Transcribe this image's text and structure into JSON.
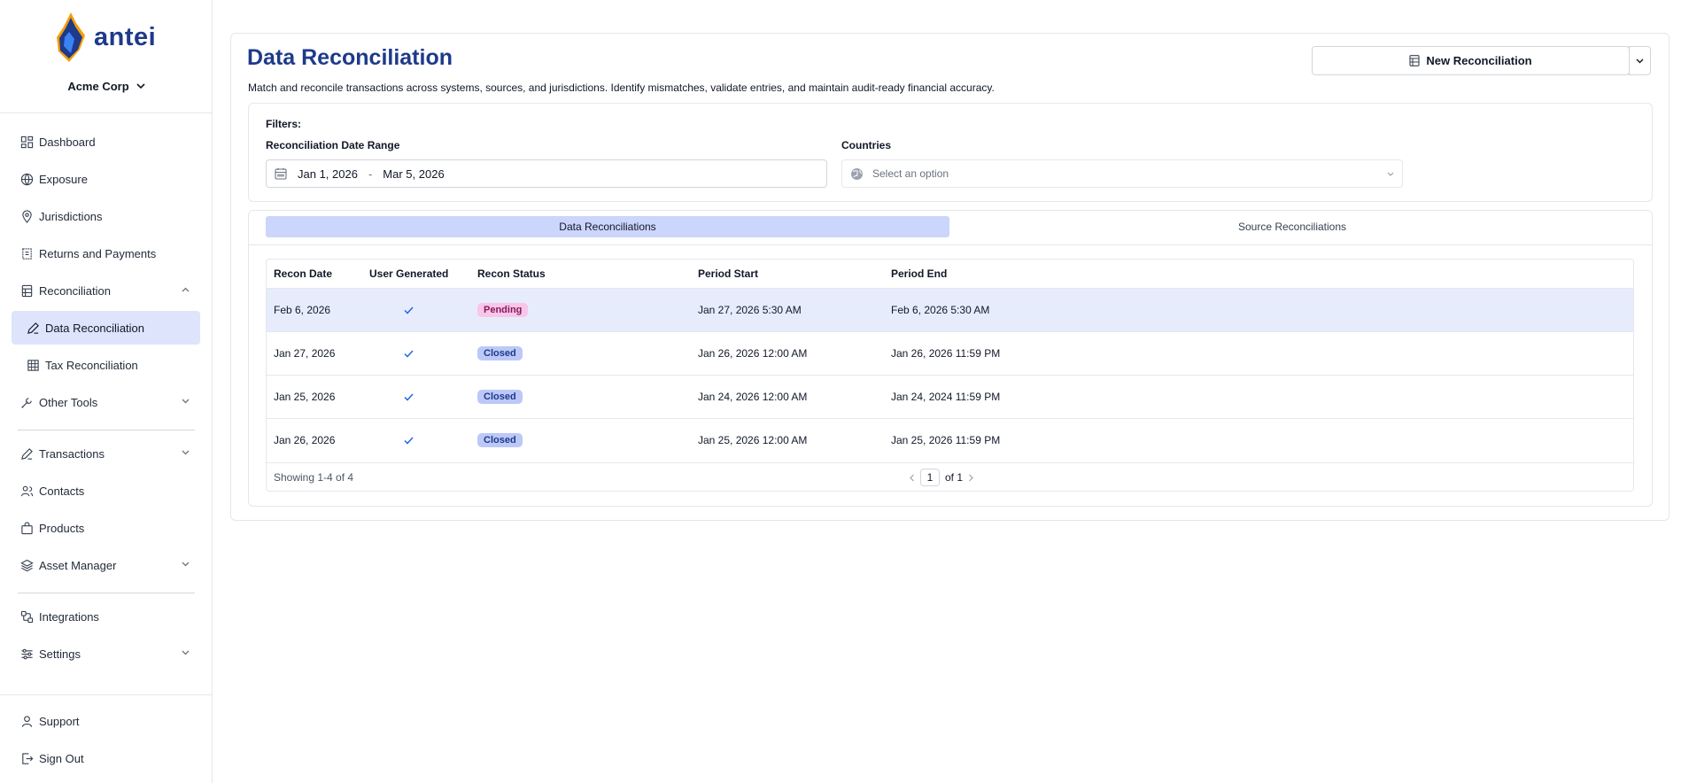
{
  "app": {
    "name": "antei",
    "org": "Acme Corp",
    "accent": "#1e3a8a"
  },
  "sidebar": {
    "items": [
      {
        "label": "Dashboard"
      },
      {
        "label": "Exposure"
      },
      {
        "label": "Jurisdictions"
      },
      {
        "label": "Returns and Payments"
      },
      {
        "label": "Reconciliation"
      },
      {
        "label": "Data Reconciliation"
      },
      {
        "label": "Tax Reconciliation"
      },
      {
        "label": "Other Tools"
      },
      {
        "label": "Transactions"
      },
      {
        "label": "Contacts"
      },
      {
        "label": "Products"
      },
      {
        "label": "Asset Manager"
      },
      {
        "label": "Integrations"
      },
      {
        "label": "Settings"
      },
      {
        "label": "Support"
      },
      {
        "label": "Sign Out"
      }
    ]
  },
  "page": {
    "title": "Data Reconciliation",
    "subtitle": "Match and reconcile transactions across systems, sources, and jurisdictions. Identify mismatches, validate entries, and maintain audit-ready financial accuracy.",
    "new_button": "New Reconciliation"
  },
  "filters": {
    "heading": "Filters:",
    "date_range_label": "Reconciliation Date Range",
    "date_start": "Jan 1, 2026",
    "date_sep": "-",
    "date_end": "Mar 5, 2026",
    "countries_label": "Countries",
    "countries_placeholder": "Select an option"
  },
  "tabs": [
    {
      "label": "Data Reconciliations",
      "active": true
    },
    {
      "label": "Source Reconciliations",
      "active": false
    }
  ],
  "table": {
    "columns": [
      "Recon Date",
      "User Generated",
      "Recon Status",
      "Period Start",
      "Period End"
    ],
    "rows": [
      {
        "recon_date": "Feb 6, 2026",
        "user_generated": true,
        "status": "Pending",
        "period_start": "Jan 27, 2026 5:30 AM",
        "period_end": "Feb 6, 2026 5:30 AM"
      },
      {
        "recon_date": "Jan 27, 2026",
        "user_generated": true,
        "status": "Closed",
        "period_start": "Jan 26, 2026 12:00 AM",
        "period_end": "Jan 26, 2026 11:59 PM"
      },
      {
        "recon_date": "Jan 25, 2026",
        "user_generated": true,
        "status": "Closed",
        "period_start": "Jan 24, 2026 12:00 AM",
        "period_end": "Jan 24, 2024 11:59 PM"
      },
      {
        "recon_date": "Jan 26, 2026",
        "user_generated": true,
        "status": "Closed",
        "period_start": "Jan 25, 2026 12:00 AM",
        "period_end": "Jan 25, 2026 11:59 PM"
      }
    ],
    "footer": {
      "showing": "Showing 1-4 of 4",
      "page": "1",
      "of_text": "of 1"
    }
  }
}
